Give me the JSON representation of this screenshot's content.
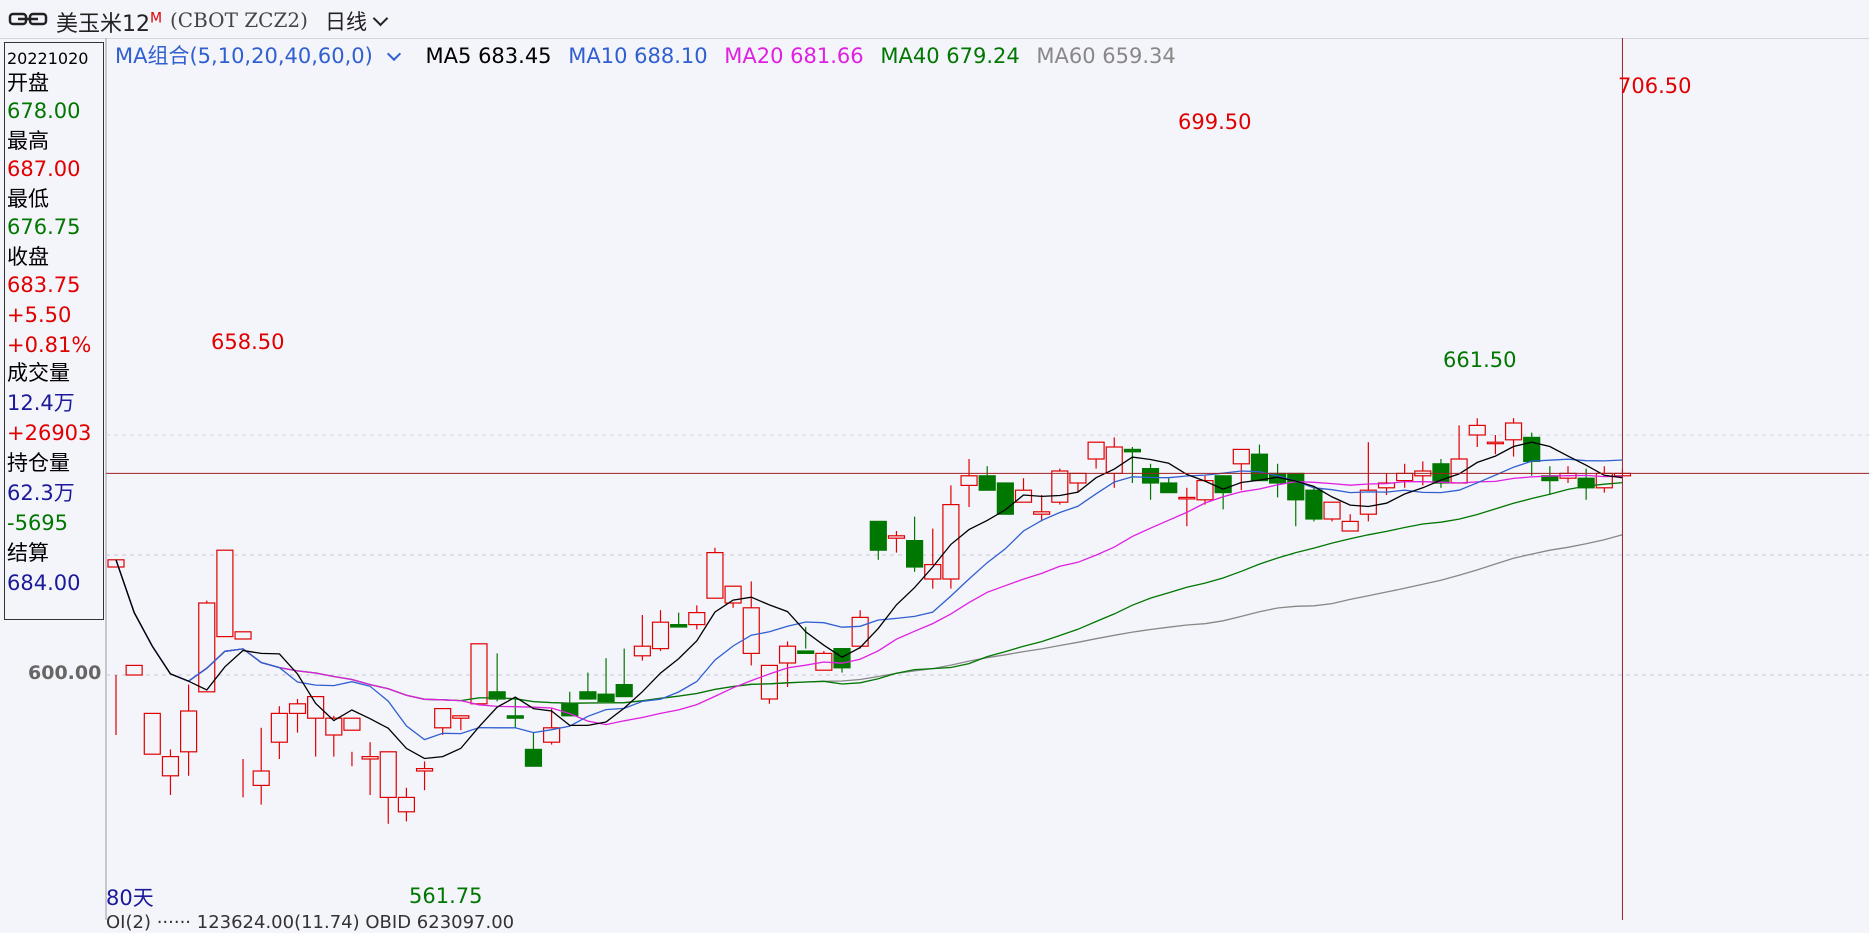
{
  "header": {
    "link_icon": "link-chain-icon",
    "symbol_name": "美玉米12",
    "symbol_sup": "M",
    "symbol_code": "(CBOT ZCZ2)",
    "period": "日线"
  },
  "info": {
    "date": "20221020",
    "open_label": "开盘",
    "open": "678.00",
    "high_label": "最高",
    "high": "687.00",
    "low_label": "最低",
    "low": "676.75",
    "close_label": "收盘",
    "close": "683.75",
    "change": "+5.50",
    "change_pct": "+0.81%",
    "volume_label": "成交量",
    "volume": "12.4万",
    "volume_change": "+26903",
    "oi_label": "持仓量",
    "oi": "62.3万",
    "oi_change": "-5695",
    "settle_label": "结算",
    "settle": "684.00"
  },
  "ma_legend": {
    "combo": "MA组合(5,10,20,40,60,0)",
    "ma5": "MA5 683.45",
    "ma10": "MA10 688.10",
    "ma20": "MA20 681.66",
    "ma40": "MA40 679.24",
    "ma60": "MA60 659.34"
  },
  "annotations": {
    "high1": "658.50",
    "high2": "699.50",
    "high3": "706.50",
    "low1": "561.75",
    "low2": "661.50"
  },
  "y_axis_label": "600.00",
  "period_count": "80天",
  "bottom_strip": "OI(2)    ······ 123624.00(11.74)  OBID 623097.00",
  "colors": {
    "up": "#e00000",
    "down": "#007700",
    "ma5": "#000000",
    "ma10": "#3060d0",
    "ma20": "#e020e0",
    "ma40": "#007700",
    "ma60": "#888888",
    "crosshair": "#a02020"
  },
  "chart_data": {
    "type": "candlestick",
    "y_tick": 600.0,
    "candles": [
      [
        645,
        648,
        575,
        600
      ],
      [
        600,
        604,
        567,
        567
      ],
      [
        567,
        584,
        546,
        546
      ],
      [
        558,
        566,
        550,
        569
      ],
      [
        568,
        585,
        558,
        596
      ],
      [
        593,
        630,
        596,
        631
      ],
      [
        616,
        652,
        616,
        616
      ],
      [
        615,
        618,
        549,
        565
      ],
      [
        554,
        560,
        546,
        578
      ],
      [
        572,
        584,
        565,
        587
      ],
      [
        584,
        588,
        576,
        590
      ],
      [
        582,
        591,
        566,
        586
      ],
      [
        575,
        582,
        566,
        583
      ],
      [
        577,
        582,
        562,
        568
      ],
      [
        565,
        566,
        550,
        572
      ],
      [
        549,
        568,
        538,
        554
      ],
      [
        543,
        549,
        539,
        553
      ],
      [
        560,
        561,
        552,
        564
      ],
      [
        578,
        586,
        575,
        579
      ],
      [
        582,
        583,
        577,
        583
      ],
      [
        588,
        613,
        588,
        605
      ],
      [
        593,
        590,
        589,
        609
      ],
      [
        583,
        582,
        578,
        591
      ],
      [
        569,
        562,
        565,
        576
      ],
      [
        572,
        578,
        571,
        586
      ],
      [
        588,
        583,
        585,
        593
      ],
      [
        593,
        590,
        590,
        601
      ],
      [
        592,
        589,
        590,
        607
      ],
      [
        596,
        591,
        592,
        611
      ],
      [
        608,
        612,
        606,
        625
      ],
      [
        611,
        622,
        610,
        627
      ],
      [
        621,
        620,
        620,
        626
      ],
      [
        621,
        626,
        619,
        629
      ],
      [
        632,
        651,
        633,
        653
      ],
      [
        630,
        637,
        628,
        637
      ],
      [
        609,
        628,
        604,
        639
      ],
      [
        590,
        604,
        588,
        604
      ],
      [
        605,
        612,
        595,
        614
      ],
      [
        610,
        609,
        611,
        620
      ],
      [
        602,
        609,
        604,
        610
      ],
      [
        611,
        603,
        601,
        610
      ],
      [
        612,
        624,
        611,
        627
      ],
      [
        664,
        652,
        648,
        661
      ],
      [
        657,
        658,
        651,
        660
      ],
      [
        656,
        645,
        643,
        666
      ],
      [
        640,
        646,
        636,
        661
      ],
      [
        640,
        671,
        636,
        679
      ],
      [
        679,
        683,
        670,
        690
      ],
      [
        683,
        677,
        681,
        687
      ],
      [
        680,
        667,
        673,
        680
      ],
      [
        672,
        677,
        672,
        682
      ],
      [
        667,
        668,
        664,
        675
      ],
      [
        672,
        685,
        671,
        686
      ],
      [
        680,
        684,
        676,
        684
      ],
      [
        690,
        697,
        686,
        696
      ],
      [
        684,
        695,
        678,
        699
      ],
      [
        694,
        693,
        680,
        695
      ],
      [
        686,
        680,
        673,
        688
      ],
      [
        680,
        676,
        676,
        682
      ],
      [
        674,
        674,
        662,
        678
      ],
      [
        673,
        681,
        671,
        683
      ],
      [
        683,
        676,
        669,
        682
      ],
      [
        688,
        694,
        677,
        689
      ],
      [
        692,
        681,
        686,
        696
      ],
      [
        684,
        680,
        674,
        688
      ],
      [
        684,
        673,
        662,
        682
      ],
      [
        677,
        665,
        664,
        678
      ],
      [
        665,
        672,
        664,
        670
      ],
      [
        660,
        664,
        661,
        667
      ],
      [
        667,
        677,
        664,
        697
      ],
      [
        678,
        680,
        675,
        684
      ],
      [
        681,
        684,
        678,
        688
      ],
      [
        683,
        685,
        679,
        689
      ],
      [
        688,
        680,
        678,
        690
      ],
      [
        680,
        690,
        680,
        704
      ],
      [
        700,
        704,
        695,
        707
      ],
      [
        697,
        697,
        692,
        700
      ],
      [
        698,
        705,
        691,
        707
      ],
      [
        699,
        689,
        683,
        701
      ],
      [
        683,
        681,
        675,
        687
      ],
      [
        682,
        684,
        680,
        687
      ],
      [
        682,
        678,
        673,
        686
      ],
      [
        678,
        684,
        676,
        687
      ],
      [
        683,
        684,
        682,
        686
      ]
    ]
  }
}
